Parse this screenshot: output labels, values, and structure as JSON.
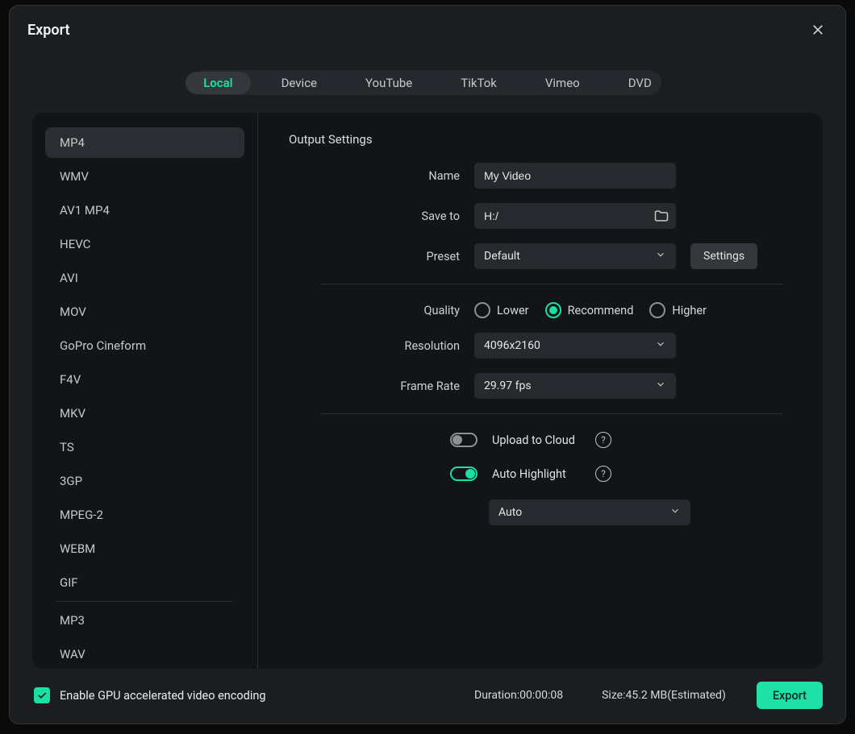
{
  "title": "Export",
  "tabs": [
    "Local",
    "Device",
    "YouTube",
    "TikTok",
    "Vimeo",
    "DVD"
  ],
  "active_tab": 0,
  "formats": [
    "MP4",
    "WMV",
    "AV1 MP4",
    "HEVC",
    "AVI",
    "MOV",
    "GoPro Cineform",
    "F4V",
    "MKV",
    "TS",
    "3GP",
    "MPEG-2",
    "WEBM",
    "GIF",
    "MP3",
    "WAV"
  ],
  "active_format": 0,
  "section_title": "Output Settings",
  "labels": {
    "name": "Name",
    "save_to": "Save to",
    "preset": "Preset",
    "settings_btn": "Settings",
    "quality": "Quality",
    "resolution": "Resolution",
    "frame_rate": "Frame Rate",
    "upload": "Upload to Cloud",
    "highlight": "Auto Highlight"
  },
  "name_value": "My Video",
  "save_to_value": "H:/",
  "preset_value": "Default",
  "quality_options": [
    "Lower",
    "Recommend",
    "Higher"
  ],
  "quality_selected": 1,
  "resolution_value": "4096x2160",
  "frame_rate_value": "29.97 fps",
  "upload_on": false,
  "highlight_on": true,
  "highlight_select": "Auto",
  "footer": {
    "gpu_checked": true,
    "gpu_label": "Enable GPU accelerated video encoding",
    "duration_label": "Duration:",
    "duration_value": "00:00:08",
    "size_label": "Size:",
    "size_value": "45.2 MB(Estimated)",
    "export_btn": "Export"
  }
}
